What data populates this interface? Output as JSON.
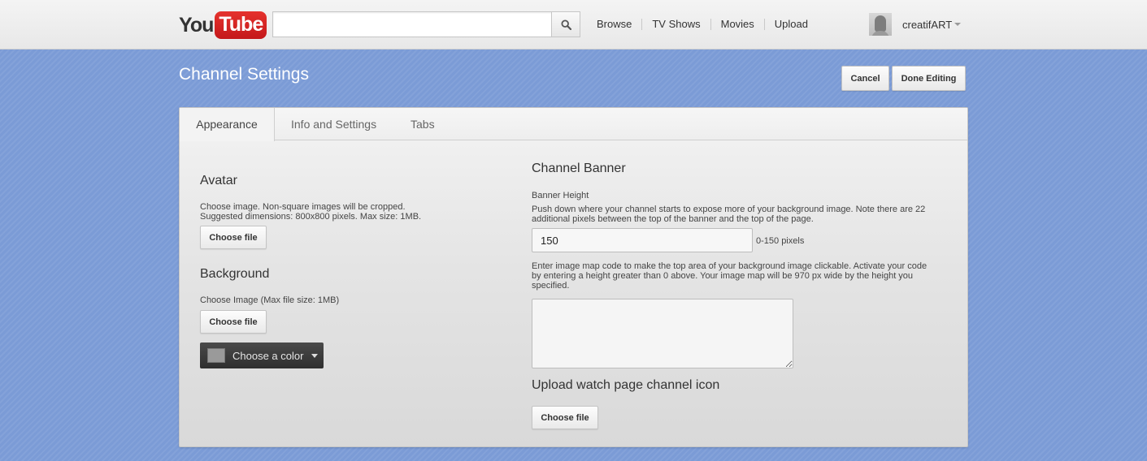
{
  "masthead": {
    "logo_you": "You",
    "logo_tube": "Tube",
    "search": {
      "value": "",
      "placeholder": ""
    },
    "nav": [
      "Browse",
      "TV Shows",
      "Movies",
      "Upload"
    ],
    "username": "creatifART"
  },
  "header": {
    "title": "Channel Settings",
    "cancel_label": "Cancel",
    "done_label": "Done Editing"
  },
  "tabs": [
    {
      "label": "Appearance",
      "active": true
    },
    {
      "label": "Info and Settings",
      "active": false
    },
    {
      "label": "Tabs",
      "active": false
    }
  ],
  "avatar": {
    "heading": "Avatar",
    "help_line1": "Choose image. Non-square images will be cropped.",
    "help_line2": "Suggested dimensions: 800x800 pixels. Max size: 1MB.",
    "button": "Choose file"
  },
  "background": {
    "heading": "Background",
    "help": "Choose Image (Max file size: 1MB)",
    "button": "Choose file",
    "color_button": "Choose a color",
    "color_swatch": "#9a9a9a"
  },
  "banner": {
    "heading": "Channel Banner",
    "height_label": "Banner Height",
    "help_line1": "Push down where your channel starts to expose more of your background image. Note there are 22",
    "help_line2": "additional pixels between the top of the banner and the top of the page.",
    "height_value": "150",
    "height_range": "0-150 pixels",
    "imagemap_line1": "Enter image map code to make the top area of your background image clickable. Activate your code",
    "imagemap_line2": "by entering a height greater than 0 above. Your image map will be 970 px wide by the height you",
    "imagemap_line3": "specified.",
    "imagemap_value": ""
  },
  "icon_upload": {
    "heading": "Upload watch page channel icon",
    "button": "Choose file"
  },
  "colors": {
    "page_background": "#7b9bd6",
    "logo_red": "#d42222"
  }
}
